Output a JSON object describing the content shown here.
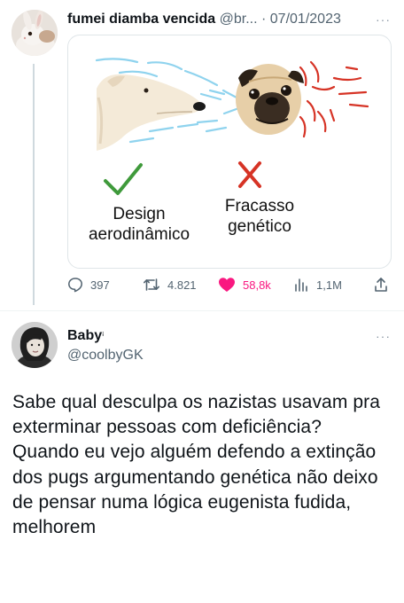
{
  "tweet1": {
    "author_name": "fumei diamba vencida",
    "handle": "@br...",
    "separator": "·",
    "date": "07/01/2023",
    "more": "···",
    "media": {
      "left_label_line1": "Design",
      "left_label_line2": "aerodinâmico",
      "right_label_line1": "Fracasso",
      "right_label_line2": "genético",
      "left_mark_color": "#3f9a3b",
      "right_mark_color": "#d63325"
    },
    "actions": {
      "replies": "397",
      "retweets": "4.821",
      "likes": "58,8k",
      "views": "1,1M"
    },
    "colors": {
      "like": "#f91880",
      "line": "#cfd9de"
    }
  },
  "tweet2": {
    "author_name": "Baby",
    "name_suffix": "ⁱ",
    "handle": "@coolbyGK",
    "more": "···",
    "text": "Sabe qual desculpa os nazistas usavam pra exterminar pessoas com deficiência? Quando eu vejo alguém defendo a extinção dos pugs argumentando genética não deixo de pensar numa lógica eugenista fudida, melhorem"
  }
}
